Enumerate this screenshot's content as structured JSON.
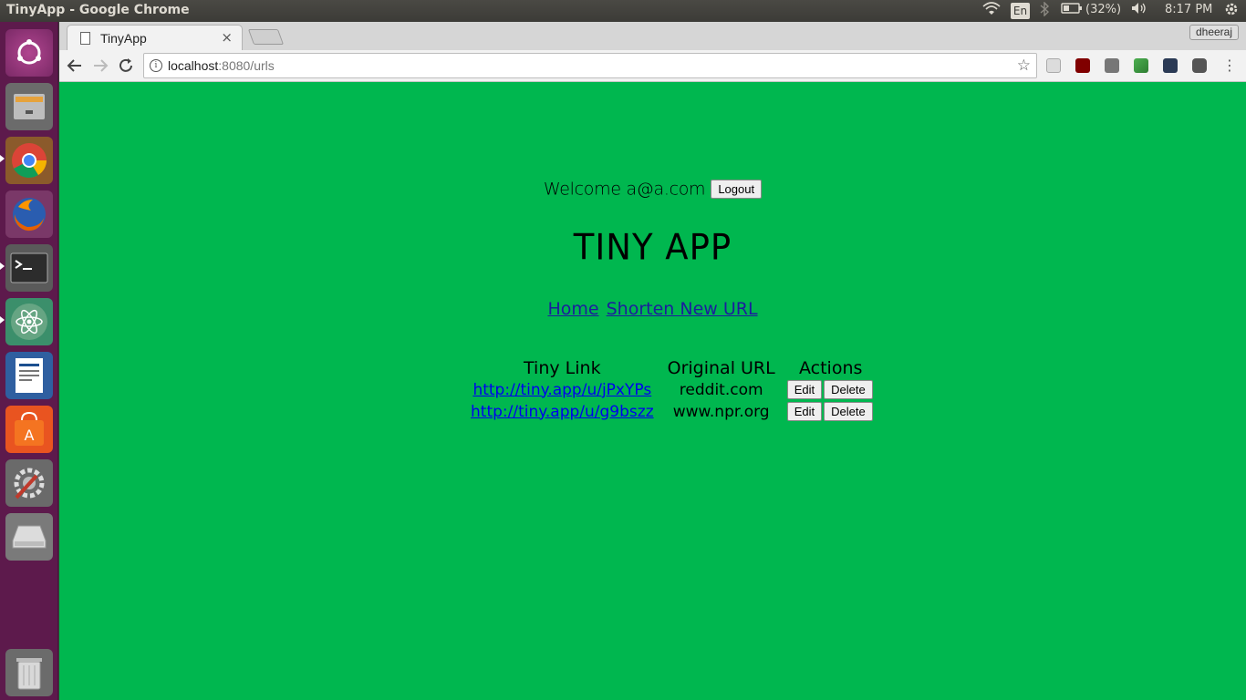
{
  "os": {
    "window_title": "TinyApp - Google Chrome",
    "lang": "En",
    "battery": "(32%)",
    "time": "8:17 PM",
    "user": "dheeraj"
  },
  "launcher": {
    "items": [
      "ubuntu-dash",
      "files",
      "chrome",
      "firefox",
      "terminal",
      "atom",
      "writer",
      "software-center",
      "system-settings",
      "disk",
      "trash"
    ]
  },
  "browser": {
    "tab_title": "TinyApp",
    "tab_close": "×",
    "url_host": "localhost",
    "url_rest": ":8080/urls",
    "star": "☆"
  },
  "page": {
    "welcome": "Welcome a@a.com",
    "logout_label": "Logout",
    "title": "TINY APP",
    "nav": {
      "home": "Home",
      "shorten": "Shorten New URL"
    },
    "table": {
      "headers": [
        "Tiny Link",
        "Original URL",
        "Actions"
      ],
      "rows": [
        {
          "tiny": "http://tiny.app/u/jPxYPs",
          "original": "reddit.com",
          "edit": "Edit",
          "delete": "Delete"
        },
        {
          "tiny": "http://tiny.app/u/g9bszz",
          "original": "www.npr.org",
          "edit": "Edit",
          "delete": "Delete"
        }
      ]
    }
  },
  "colors": {
    "page_bg": "#00b74f",
    "launcher_bg": "#5d1a4c",
    "panel_bg": "#3c3b37"
  }
}
